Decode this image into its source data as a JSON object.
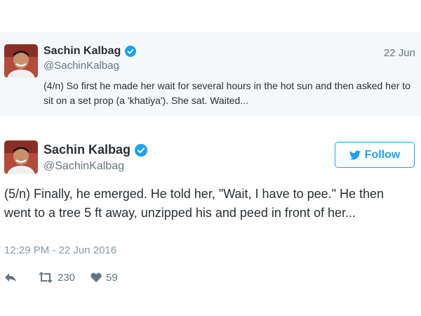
{
  "quoted_tweet": {
    "author_name": "Sachin Kalbag",
    "handle": "@SachinKalbag",
    "date": "22 Jun",
    "text": "(4/n) So first he made her wait for several hours in the hot sun and then asked her to sit on a set prop (a 'khatiya'). She sat. Waited..."
  },
  "tweet": {
    "author_name": "Sachin Kalbag",
    "handle": "@SachinKalbag",
    "follow_label": "Follow",
    "text": "(5/n) Finally, he emerged. He told her, \"Wait, I have to pee.\" He then went to a tree 5 ft away, unzipped his and peed in front of her...",
    "timestamp": "12:29 PM - 22 Jun 2016",
    "retweet_count": "230",
    "like_count": "59"
  },
  "icons": {
    "verified": "verified-badge-icon",
    "follow": "twitter-bird-icon",
    "reply": "reply-arrow-icon",
    "retweet": "retweet-icon",
    "like": "heart-icon"
  },
  "colors": {
    "accent": "#1da1f2",
    "quoted_background": "#f5f8fa",
    "text": "#292f33",
    "muted": "#66757f"
  }
}
